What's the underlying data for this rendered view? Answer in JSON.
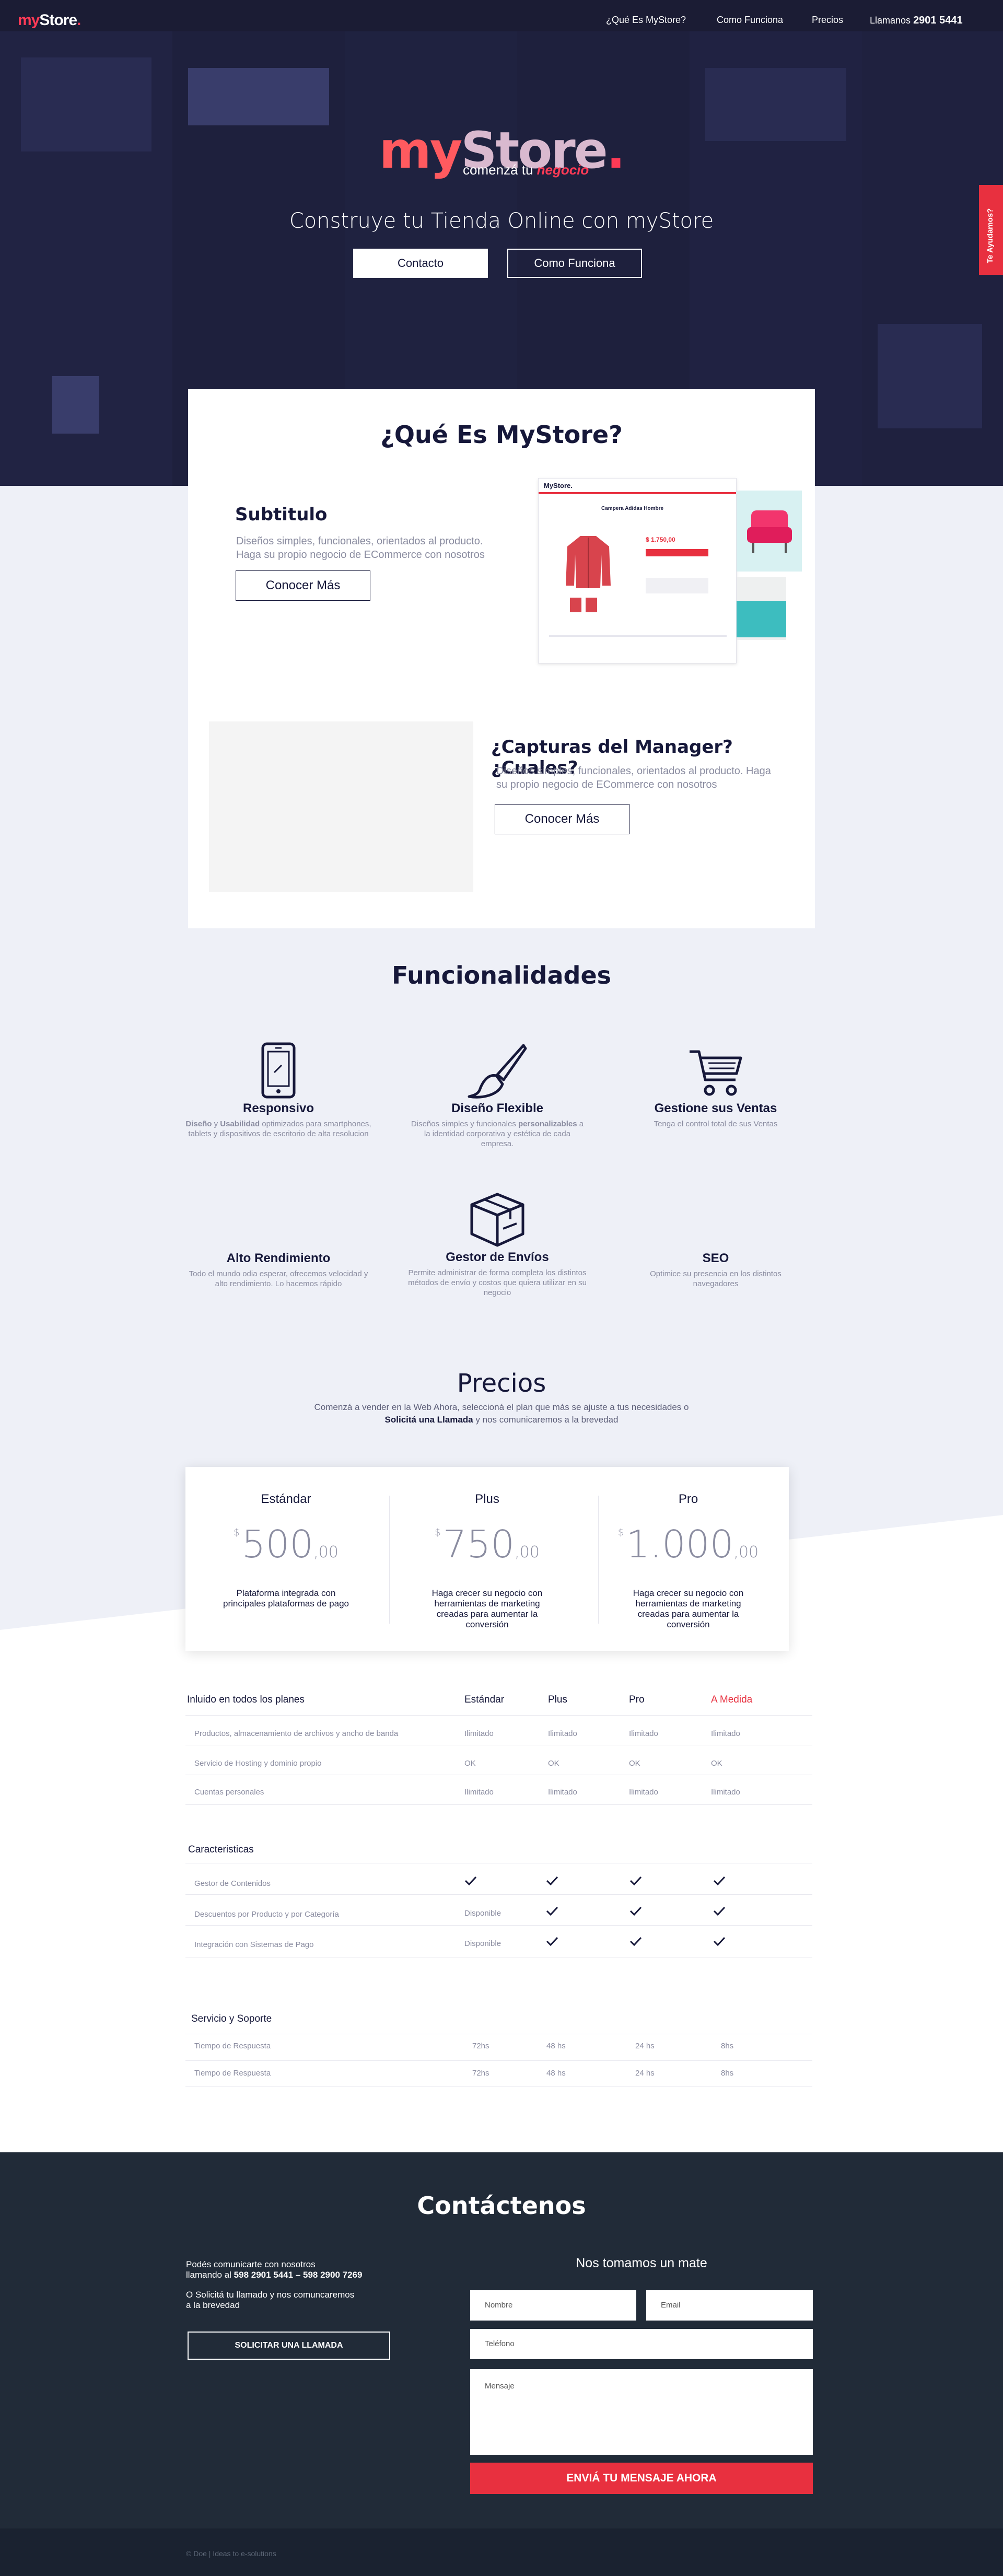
{
  "nav": {
    "logo_my": "my",
    "logo_store": "Store",
    "logo_dot": ".",
    "links": [
      "¿Qué Es MyStore?",
      "Como Funciona",
      "Precios"
    ],
    "phone_label": "Llamanos",
    "phone_number": "2901 5441"
  },
  "hero": {
    "logo_my": "my",
    "logo_store": "Store",
    "logo_dot": ".",
    "logo_sub": "comenzá tu",
    "logo_sub_accent": "negocio",
    "tagline": "Construye tu Tienda Online con myStore",
    "btn_contact": "Contacto",
    "btn_how": "Como Funciona",
    "side_tab": "Te Ayudamos?"
  },
  "whatis": {
    "title": "¿Qué Es MyStore?",
    "block1": {
      "subtitle": "Subtitulo",
      "desc": "Diseños simples, funcionales, orientados al producto. Haga su propio negocio de ECommerce con nosotros",
      "btn": "Conocer Más"
    },
    "mock": {
      "brand": "MyStore.",
      "product_title": "Campera Adidas Hombre",
      "price": "$ 1.750,00"
    },
    "block2": {
      "title": "¿Capturas del Manager? ¿Cuales?",
      "desc": "Diseños simples, funcionales, orientados al producto. Haga su propio negocio de ECommerce con nosotros",
      "btn": "Conocer Más"
    }
  },
  "features": {
    "title": "Funcionalidades",
    "items": [
      {
        "icon": "mobile-icon",
        "title": "Responsivo",
        "desc_b1": "Diseño",
        "desc_mid": " y ",
        "desc_b2": "Usabilidad",
        "desc_rest": " optimizados para smartphones, tablets y dispositivos de escritorio de alta resolucion"
      },
      {
        "icon": "paintbrush-icon",
        "title": "Diseño Flexible",
        "desc_pre": "Diseños simples y funcionales ",
        "desc_b": "personalizables",
        "desc_post": " a la identidad corporativa y estética de cada empresa."
      },
      {
        "icon": "cart-icon",
        "title": "Gestione sus Ventas",
        "desc": "Tenga el control total de sus Ventas"
      },
      {
        "icon": "none",
        "title": "Alto Rendimiento",
        "desc": "Todo el mundo odia esperar, ofrecemos velocidad y alto rendimiento. Lo hacemos rápido"
      },
      {
        "icon": "box-icon",
        "title": "Gestor de Envíos",
        "desc": "Permite administrar de forma completa los distintos métodos de envío y costos que quiera utilizar en su negocio"
      },
      {
        "icon": "none",
        "title": "SEO",
        "desc": "Optimice su presencia en los distintos navegadores"
      }
    ]
  },
  "pricing": {
    "title": "Precios",
    "subtitle": "Comenzá a vender en la Web Ahora, seleccioná el plan que más se ajuste a tus necesidades o",
    "subtitle_bold": "Solicitá una Llamada",
    "subtitle_end": " y nos comunicaremos a la brevedad",
    "plans": [
      {
        "name": "Estándar",
        "currency": "$",
        "amount": "500",
        "cents": ",00",
        "desc": "Plataforma integrada con principales plataformas de pago"
      },
      {
        "name": "Plus",
        "currency": "$",
        "amount": "750",
        "cents": ",00",
        "desc": "Haga crecer su negocio con herramientas de marketing creadas para aumentar la conversión"
      },
      {
        "name": "Pro",
        "currency": "$",
        "amount": "1.000",
        "cents": ",00",
        "desc": "Haga crecer su negocio con herramientas de marketing creadas para aumentar la conversión"
      }
    ],
    "table": {
      "included_title": "Inluido en todos los planes",
      "columns": [
        "Estándar",
        "Plus",
        "Pro",
        "A Medida"
      ],
      "included_rows": [
        {
          "label": "Productos, almacenamiento de archivos y ancho de banda",
          "values": [
            "Ilimitado",
            "Ilimitado",
            "Ilimitado",
            "Ilimitado"
          ]
        },
        {
          "label": "Servicio de Hosting y dominio propio",
          "values": [
            "OK",
            "OK",
            "OK",
            "OK"
          ]
        },
        {
          "label": "Cuentas personales",
          "values": [
            "Ilimitado",
            "Ilimitado",
            "Ilimitado",
            "Ilimitado"
          ]
        }
      ],
      "features_title": "Caracteristicas",
      "feature_rows": [
        {
          "label": "Gestor de Contenidos",
          "values": [
            "check",
            "check",
            "check",
            "check"
          ]
        },
        {
          "label": "Descuentos por Producto y por Categoría",
          "values": [
            "Disponible",
            "check",
            "check",
            "check"
          ]
        },
        {
          "label": "Integración con Sistemas de Pago",
          "values": [
            "Disponible",
            "check",
            "check",
            "check"
          ]
        }
      ],
      "support_title": "Servicio y Soporte",
      "support_rows": [
        {
          "label": "Tiempo de Respuesta",
          "values": [
            "72hs",
            "48 hs",
            "24 hs",
            "8hs"
          ]
        },
        {
          "label": "Tiempo de Respuesta",
          "values": [
            "72hs",
            "48 hs",
            "24 hs",
            "8hs"
          ]
        }
      ]
    }
  },
  "contact": {
    "title": "Contáctenos",
    "line1": "Podés comunicarte con nosotros",
    "line2_pre": "llamando al ",
    "line2_phones": "598 2901 5441 – 598 2900 7269",
    "line3": "O Solicitá tu llamado y nos comuncaremos",
    "line4": "a la brevedad",
    "btn_call": "SOLICITAR  UNA LLAMADA",
    "form_title": "Nos tomamos un mate",
    "ph_name": "Nombre",
    "ph_email": "Email",
    "ph_phone": "Teléfono",
    "ph_message": "Mensaje",
    "btn_send": "ENVIÁ TU MENSAJE AHORA"
  },
  "footer": {
    "text": "© Doe | Ideas to e-solutions"
  },
  "colors": {
    "accent": "#e8303f",
    "navy": "#16183a",
    "contact_bg": "#212b38"
  }
}
